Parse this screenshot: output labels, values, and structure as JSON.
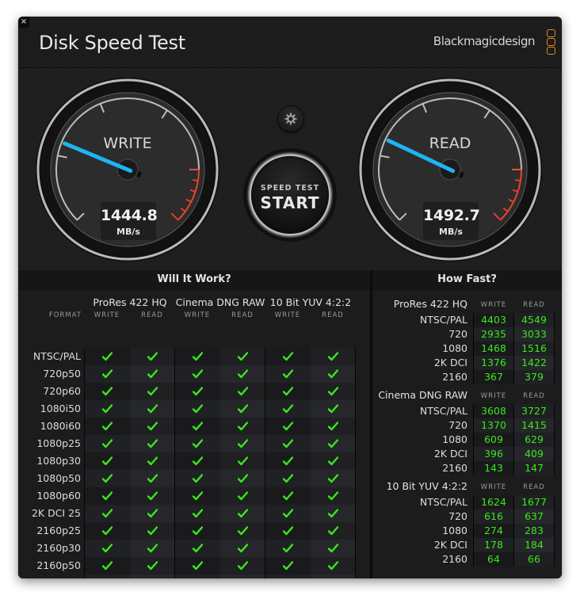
{
  "window": {
    "title": "Disk Speed Test",
    "brand": "Blackmagicdesign",
    "close_icon": "x-icon"
  },
  "gauges": {
    "write": {
      "label": "WRITE",
      "value": "1444.8",
      "unit": "MB/s",
      "needle_fraction": 0.25
    },
    "read": {
      "label": "READ",
      "value": "1492.7",
      "unit": "MB/s",
      "needle_fraction": 0.26
    }
  },
  "controls": {
    "settings_icon": "gear-icon",
    "start_line1": "SPEED TEST",
    "start_line2": "START"
  },
  "colors": {
    "needle": "#1fb4f2",
    "redline": "#e8422c",
    "ok": "#39e81e",
    "brand_logo": "#e08a1c"
  },
  "will_it_work": {
    "title": "Will It Work?",
    "format_header": "FORMAT",
    "codecs": [
      "ProRes 422 HQ",
      "Cinema DNG RAW",
      "10 Bit YUV 4:2:2"
    ],
    "subcols": [
      "WRITE",
      "READ"
    ],
    "rows": [
      {
        "format": "NTSC/PAL",
        "ok": [
          true,
          true,
          true,
          true,
          true,
          true
        ]
      },
      {
        "format": "720p50",
        "ok": [
          true,
          true,
          true,
          true,
          true,
          true
        ]
      },
      {
        "format": "720p60",
        "ok": [
          true,
          true,
          true,
          true,
          true,
          true
        ]
      },
      {
        "format": "1080i50",
        "ok": [
          true,
          true,
          true,
          true,
          true,
          true
        ]
      },
      {
        "format": "1080i60",
        "ok": [
          true,
          true,
          true,
          true,
          true,
          true
        ]
      },
      {
        "format": "1080p25",
        "ok": [
          true,
          true,
          true,
          true,
          true,
          true
        ]
      },
      {
        "format": "1080p30",
        "ok": [
          true,
          true,
          true,
          true,
          true,
          true
        ]
      },
      {
        "format": "1080p50",
        "ok": [
          true,
          true,
          true,
          true,
          true,
          true
        ]
      },
      {
        "format": "1080p60",
        "ok": [
          true,
          true,
          true,
          true,
          true,
          true
        ]
      },
      {
        "format": "2K DCI 25",
        "ok": [
          true,
          true,
          true,
          true,
          true,
          true
        ]
      },
      {
        "format": "2160p25",
        "ok": [
          true,
          true,
          true,
          true,
          true,
          true
        ]
      },
      {
        "format": "2160p30",
        "ok": [
          true,
          true,
          true,
          true,
          true,
          true
        ]
      },
      {
        "format": "2160p50",
        "ok": [
          true,
          true,
          true,
          true,
          true,
          true
        ]
      },
      {
        "format": "2160p60",
        "ok": [
          true,
          true,
          true,
          true,
          true,
          true
        ]
      }
    ]
  },
  "how_fast": {
    "title": "How Fast?",
    "write_label": "WRITE",
    "read_label": "READ",
    "groups": [
      {
        "codec": "ProRes 422 HQ",
        "rows": [
          {
            "res": "NTSC/PAL",
            "write": "4403",
            "read": "4549"
          },
          {
            "res": "720",
            "write": "2935",
            "read": "3033"
          },
          {
            "res": "1080",
            "write": "1468",
            "read": "1516"
          },
          {
            "res": "2K DCI",
            "write": "1376",
            "read": "1422"
          },
          {
            "res": "2160",
            "write": "367",
            "read": "379"
          }
        ]
      },
      {
        "codec": "Cinema DNG RAW",
        "rows": [
          {
            "res": "NTSC/PAL",
            "write": "3608",
            "read": "3727"
          },
          {
            "res": "720",
            "write": "1370",
            "read": "1415"
          },
          {
            "res": "1080",
            "write": "609",
            "read": "629"
          },
          {
            "res": "2K DCI",
            "write": "396",
            "read": "409"
          },
          {
            "res": "2160",
            "write": "143",
            "read": "147"
          }
        ]
      },
      {
        "codec": "10 Bit YUV 4:2:2",
        "rows": [
          {
            "res": "NTSC/PAL",
            "write": "1624",
            "read": "1677"
          },
          {
            "res": "720",
            "write": "616",
            "read": "637"
          },
          {
            "res": "1080",
            "write": "274",
            "read": "283"
          },
          {
            "res": "2K DCI",
            "write": "178",
            "read": "184"
          },
          {
            "res": "2160",
            "write": "64",
            "read": "66"
          }
        ]
      }
    ]
  }
}
